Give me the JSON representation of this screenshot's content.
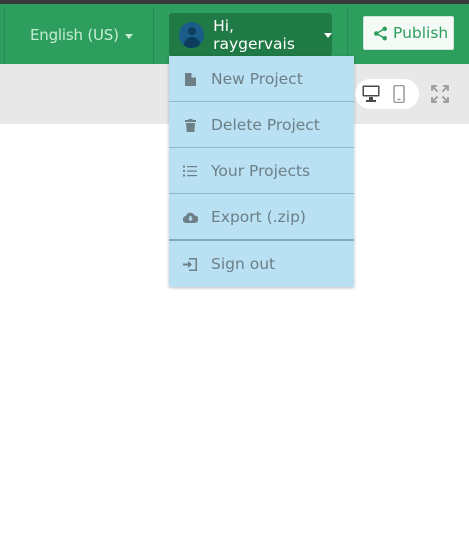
{
  "topbar": {
    "language": {
      "label": "English (US)"
    },
    "user": {
      "greeting": "Hi, raygervais"
    },
    "publish": {
      "label": "Publish"
    }
  },
  "toolbar": {
    "devices": [
      {
        "name": "desktop-icon",
        "active": true
      },
      {
        "name": "mobile-icon",
        "active": false
      }
    ],
    "fullscreen_icon": "expand-icon"
  },
  "user_menu": {
    "items": [
      {
        "label": "New Project",
        "icon": "file-icon"
      },
      {
        "label": "Delete Project",
        "icon": "trash-icon"
      },
      {
        "label": "Your Projects",
        "icon": "list-icon"
      },
      {
        "label": "Export (.zip)",
        "icon": "cloud-download-icon"
      },
      {
        "label": "Sign out",
        "icon": "sign-out-icon"
      }
    ]
  },
  "colors": {
    "brand_green": "#2e9e5e",
    "menu_bg": "#b9e0f3",
    "toolbar_bg": "#e8e8e8"
  }
}
